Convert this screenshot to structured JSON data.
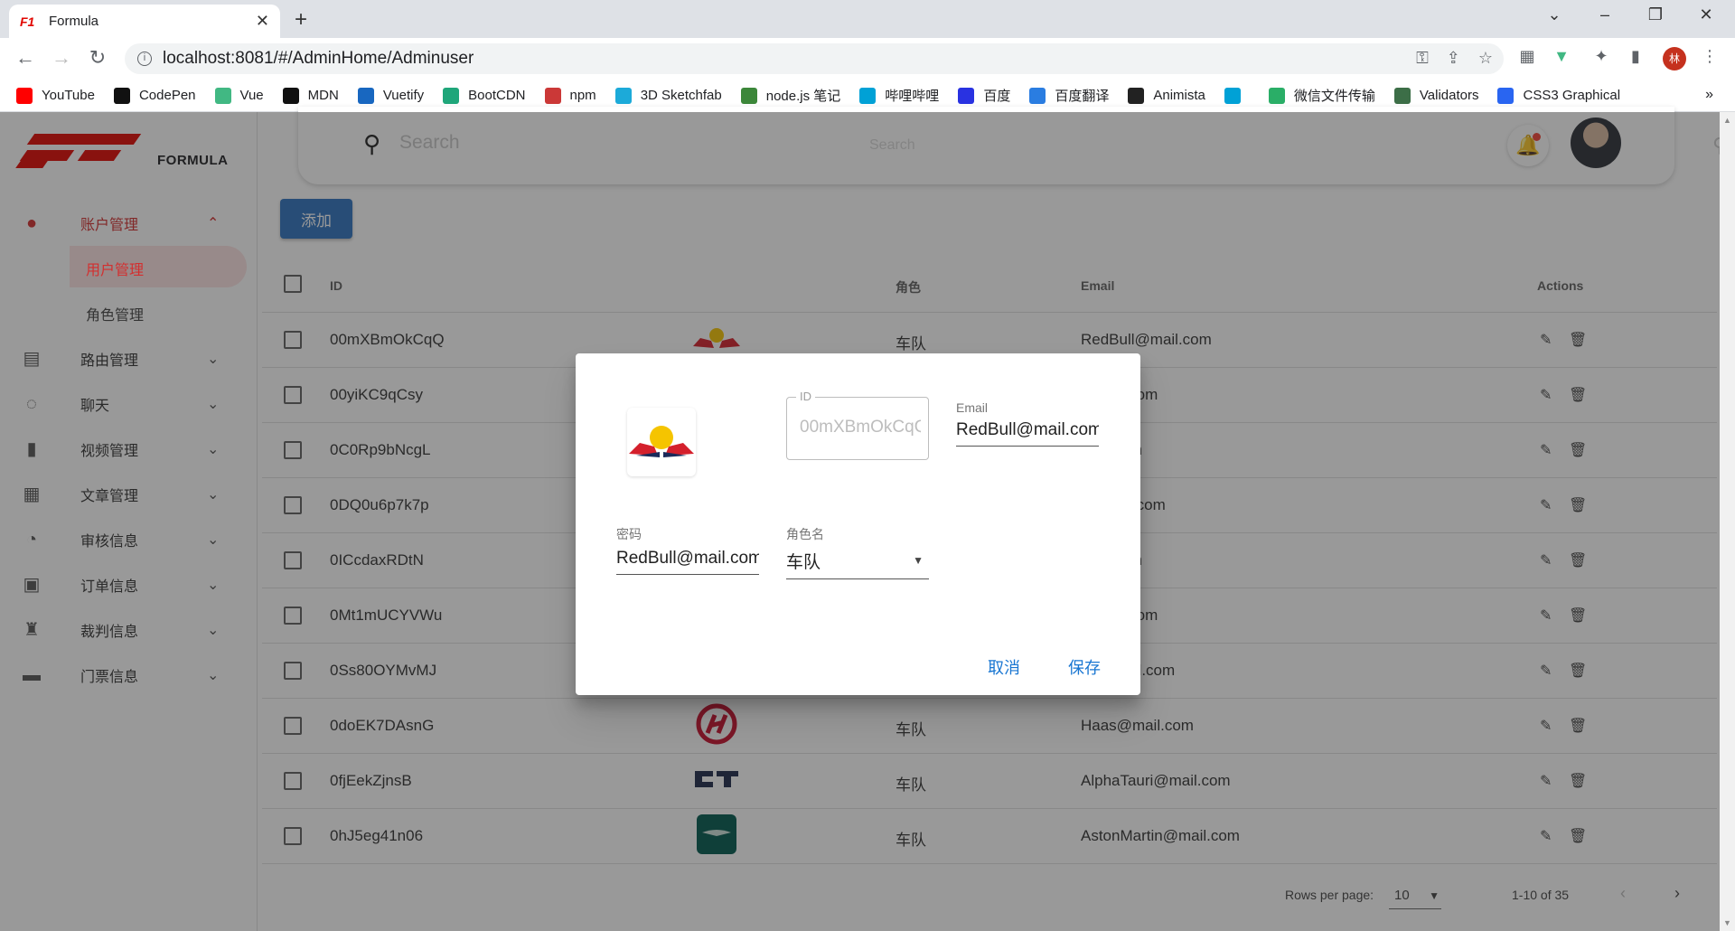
{
  "browser": {
    "tab_title": "Formula",
    "url": "localhost:8081/#/AdminHome/Adminuser",
    "bookmarks": [
      {
        "label": "YouTube",
        "color": "#ff0000"
      },
      {
        "label": "CodePen",
        "color": "#111111"
      },
      {
        "label": "Vue",
        "color": "#41b883"
      },
      {
        "label": "MDN",
        "color": "#111111"
      },
      {
        "label": "Vuetify",
        "color": "#1867c0"
      },
      {
        "label": "BootCDN",
        "color": "#1fa67a"
      },
      {
        "label": "npm",
        "color": "#cb3837"
      },
      {
        "label": "3D Sketchfab",
        "color": "#1caad9"
      },
      {
        "label": "node.js 笔记",
        "color": "#3c873a"
      },
      {
        "label": "哔哩哔哩",
        "color": "#00a1d6"
      },
      {
        "label": "百度",
        "color": "#2932e1"
      },
      {
        "label": "百度翻译",
        "color": "#2a7de1"
      },
      {
        "label": "Animista",
        "color": "#222222"
      },
      {
        "label": "",
        "color": "#00a1d6"
      },
      {
        "label": "微信文件传输",
        "color": "#2aae67"
      },
      {
        "label": "Validators",
        "color": "#3c6e47"
      },
      {
        "label": "CSS3 Graphical",
        "color": "#2965f1"
      }
    ],
    "profile_initial": "林"
  },
  "sidebar": {
    "logo_text": "FORMULA",
    "items": [
      {
        "label": "账户管理",
        "icon": "person-icon",
        "active": true,
        "expanded": true,
        "children": [
          {
            "label": "用户管理",
            "selected": true
          },
          {
            "label": "角色管理",
            "selected": false
          }
        ]
      },
      {
        "label": "路由管理",
        "icon": "sign-icon"
      },
      {
        "label": "聊天",
        "icon": "chat-icon"
      },
      {
        "label": "视频管理",
        "icon": "video-file-icon"
      },
      {
        "label": "文章管理",
        "icon": "article-icon"
      },
      {
        "label": "审核信息",
        "icon": "user-clock-icon"
      },
      {
        "label": "订单信息",
        "icon": "order-icon"
      },
      {
        "label": "裁判信息",
        "icon": "referee-icon"
      },
      {
        "label": "门票信息",
        "icon": "ticket-icon"
      }
    ]
  },
  "topbar": {
    "search_placeholder": "Search",
    "ghost_text": "Search"
  },
  "add_button": "添加",
  "table": {
    "headers": {
      "id": "ID",
      "role": "角色",
      "email": "Email",
      "actions": "Actions"
    },
    "rows": [
      {
        "id": "00mXBmOkCqQ",
        "logo": "redbull",
        "role": "车队",
        "email": "RedBull@mail.com"
      },
      {
        "id": "00yiKC9qCsy",
        "logo": "",
        "role": "",
        "email": "@mail.com"
      },
      {
        "id": "0C0Rp9bNcgL",
        "logo": "",
        "role": "",
        "email": "mail.com"
      },
      {
        "id": "0DQ0u6p7k7p",
        "logo": "",
        "role": "",
        "email": "s@mail.com"
      },
      {
        "id": "0ICcdaxRDtN",
        "logo": "",
        "role": "",
        "email": "mail.com"
      },
      {
        "id": "0Mt1mUCYVWu",
        "logo": "",
        "role": "",
        "email": "@mail.com"
      },
      {
        "id": "0Ss80OYMvMJ",
        "logo": "",
        "role": "",
        "email": "eo@mail.com"
      },
      {
        "id": "0doEK7DAsnG",
        "logo": "haas",
        "role": "车队",
        "email": "Haas@mail.com"
      },
      {
        "id": "0fjEekZjnsB",
        "logo": "alphatauri",
        "role": "车队",
        "email": "AlphaTauri@mail.com"
      },
      {
        "id": "0hJ5eg41n06",
        "logo": "astonmartin",
        "role": "车队",
        "email": "AstonMartin@mail.com"
      }
    ]
  },
  "pagination": {
    "rows_per_page_label": "Rows per page:",
    "rows_per_page": "10",
    "range": "1-10 of 35"
  },
  "dialog": {
    "id_label": "ID",
    "id_value": "00mXBmOkCqQ",
    "email_label": "Email",
    "email_value": "RedBull@mail.com",
    "password_label": "密码",
    "password_value": "RedBull@mail.com",
    "role_label": "角色名",
    "role_value": "车队",
    "cancel": "取消",
    "save": "保存"
  },
  "colors": {
    "accent": "#d32f2f",
    "primary_button": "#2f74c0",
    "dialog_button": "#1976d2"
  }
}
